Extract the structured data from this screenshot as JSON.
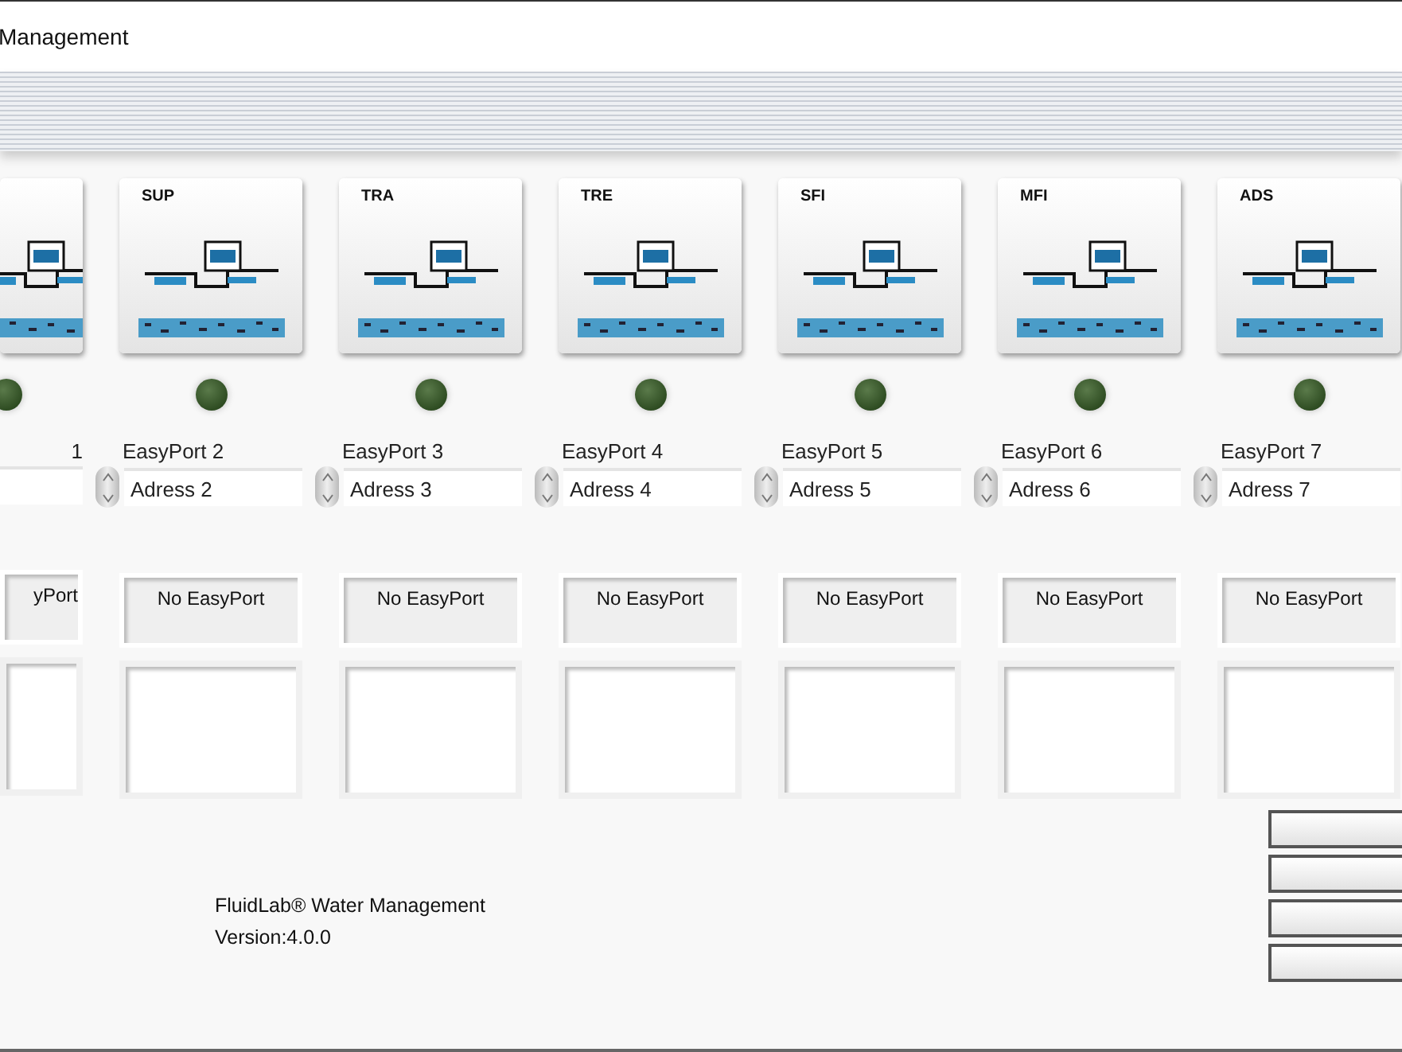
{
  "window": {
    "title": "Management"
  },
  "modules": [
    {
      "port": "1",
      "on": false,
      "status": "yPort"
    },
    {
      "code": "SUP",
      "port": "EasyPort 2",
      "address": "Adress 2",
      "on": false,
      "status": "No EasyPort"
    },
    {
      "code": "TRA",
      "port": "EasyPort 3",
      "address": "Adress 3",
      "on": false,
      "status": "No EasyPort"
    },
    {
      "code": "TRE",
      "port": "EasyPort 4",
      "address": "Adress 4",
      "on": false,
      "status": "No EasyPort"
    },
    {
      "code": "SFI",
      "port": "EasyPort 5",
      "address": "Adress 5",
      "on": false,
      "status": "No EasyPort"
    },
    {
      "code": "MFI",
      "port": "EasyPort 6",
      "address": "Adress 6",
      "on": false,
      "status": "No EasyPort"
    },
    {
      "code": "ADS",
      "port": "EasyPort 7",
      "address": "Adress 7",
      "on": false,
      "status": "No EasyPort"
    }
  ],
  "footer": {
    "product": "FluidLab®  Water Management",
    "version": "Version:4.0.0"
  }
}
